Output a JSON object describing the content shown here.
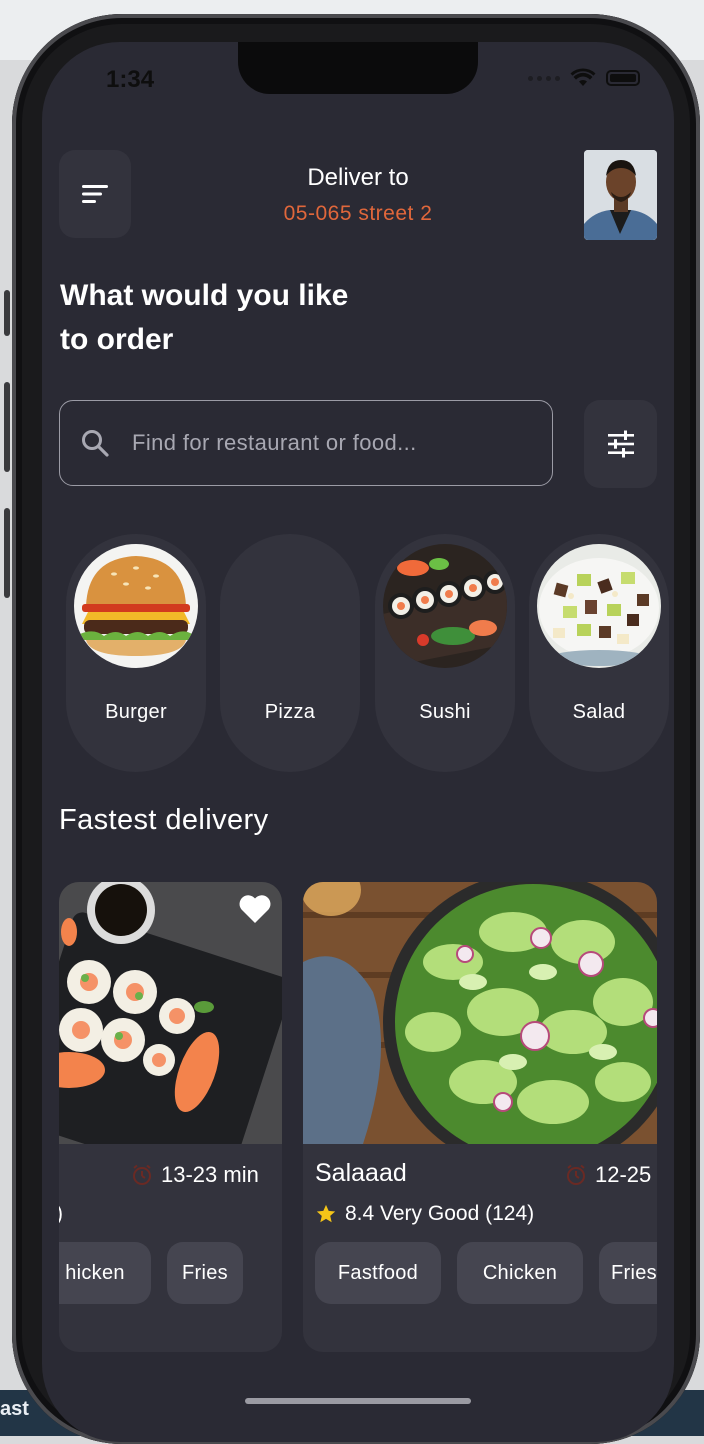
{
  "status_bar": {
    "time": "1:34"
  },
  "header": {
    "deliver_label": "Deliver to",
    "address": "05-065 street 2"
  },
  "headline": {
    "line1": "What would you like",
    "line2": "to order"
  },
  "search": {
    "placeholder": "Find for restaurant or food..."
  },
  "categories": [
    {
      "label": "Burger",
      "icon": "burger-image"
    },
    {
      "label": "Pizza",
      "icon": ""
    },
    {
      "label": "Sushi",
      "icon": "sushi-image"
    },
    {
      "label": "Salad",
      "icon": "salad-image"
    }
  ],
  "section": {
    "fastest_delivery": "Fastest delivery"
  },
  "restaurants": [
    {
      "time": "13-23 min",
      "rating_fragment": ")",
      "favorited": true,
      "tags": [
        "hicken",
        "Fries"
      ]
    },
    {
      "name": "Salaaad",
      "time": "12-25",
      "rating": "8.4 Very Good (124)",
      "tags": [
        "Fastfood",
        "Chicken",
        "Fries"
      ]
    }
  ],
  "backdrop": {
    "text": "ast"
  },
  "colors": {
    "background": "#2a2a34",
    "card": "#33333d",
    "accent": "#e0673b",
    "star": "#f5c518"
  }
}
